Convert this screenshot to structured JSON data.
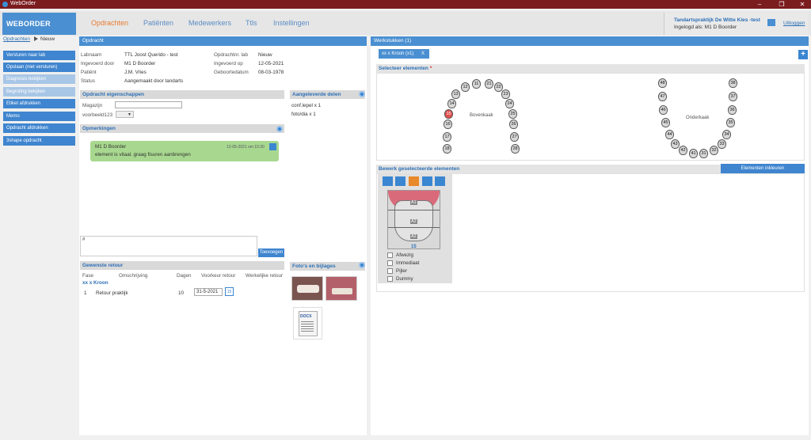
{
  "window": {
    "title": "WebOrder"
  },
  "brand": "WEBORDER",
  "nav": [
    "Opdrachten",
    "Patiënten",
    "Medewerkers",
    "Ttls",
    "Instellingen"
  ],
  "user": {
    "practice": "Tandartspraktijk De Witte Kies -test",
    "logged_in": "Ingelogd als:  M1 D Boorder",
    "logout": "Uitloggen"
  },
  "breadcrumb": {
    "parent": "Opdrachten",
    "current": "Nieuw"
  },
  "sidebar": [
    "Versturen naar lab",
    "Opslaan (niet versturen)",
    "Diagnosis bekijken",
    "Begroting bekijken",
    "Etiket afdrukken",
    "Memo",
    "Opdracht afdrukken",
    "3shape opdracht"
  ],
  "opdracht": {
    "header": "Opdracht",
    "left": [
      [
        "Labnaam",
        "TTL Joost Querido - test"
      ],
      [
        "Ingevoerd door",
        "M1 D Boorder"
      ],
      [
        "Patiënt",
        "J.M. Vries"
      ],
      [
        "Status",
        "Aangemaakt door tandarts"
      ]
    ],
    "right": [
      [
        "Opdrachtnr. lab",
        "Nieuw"
      ],
      [
        "Ingevoerd op",
        "12-05-2021"
      ],
      [
        "Geboortedatum",
        "08-03-1978"
      ]
    ]
  },
  "eigenschappen": {
    "header": "Opdracht eigenschappen",
    "magazijn_label": "Magazijn",
    "select_value": "voorbeeld123"
  },
  "opmerkingen": {
    "header": "Opmerkingen",
    "name": "M1 D Boorder",
    "date": "12-05-2021 om 15:30",
    "text": "element is vitaal. graag fisuren aanbrengen",
    "input_placeholder": "#",
    "button": "Toevoegen"
  },
  "aangeleverd": {
    "header": "Aangeleverde delen",
    "items": [
      "conf.lepel x 1",
      "foto/dia x 1"
    ]
  },
  "retour": {
    "header": "Gewenste retour",
    "columns": [
      "Fase",
      "Omschrijving",
      "Dagen",
      "Voorkeur retour",
      "Werkelijke retour"
    ],
    "group": "xx x Kroon",
    "rows": [
      [
        "1",
        "Retour praktijk",
        "10",
        "31-5-2021",
        ""
      ]
    ],
    "cal": "15"
  },
  "fotos": {
    "header": "Foto's en bijlages",
    "doc_label": "DOCX"
  },
  "werkstukken": {
    "header": "Werkstukken (1)",
    "tab": "xx x Kroon (x1)",
    "tab_close": "X",
    "add": "+"
  },
  "selecteer": {
    "header": "Selecteer elementen",
    "required": "*",
    "bovenkaak": "Bovenkaak",
    "onderkaak": "Onderkaak",
    "upper_right": [
      "11",
      "12",
      "13",
      "14",
      "15",
      "16",
      "17",
      "18"
    ],
    "upper_left": [
      "21",
      "22",
      "23",
      "24",
      "25",
      "26",
      "27",
      "28"
    ],
    "lower_left": [
      "31",
      "32",
      "33",
      "34",
      "35",
      "36",
      "37",
      "38"
    ],
    "lower_right": [
      "41",
      "42",
      "43",
      "44",
      "45",
      "46",
      "47",
      "48"
    ],
    "selected": "15"
  },
  "bewerk": {
    "header": "Bewerk geselecteerde elementen",
    "button": "Elementen inkleuren",
    "tooth": "15",
    "zones": [
      "A1",
      "A2",
      "A2"
    ],
    "checks": [
      "Afwezig",
      "Immediaat",
      "Pijler",
      "Dummy"
    ]
  }
}
